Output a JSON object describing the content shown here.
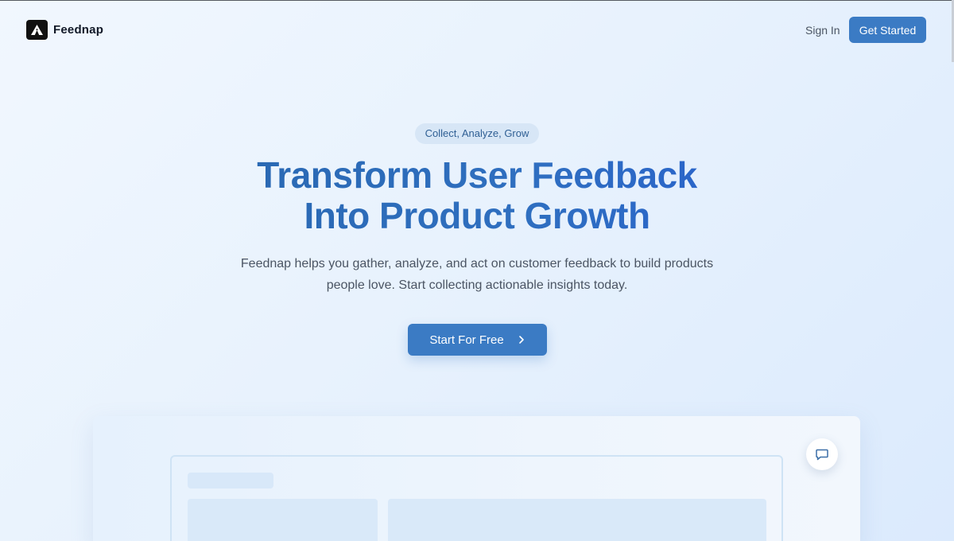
{
  "brand": {
    "name": "Feednap",
    "logo_icon": "triangle-logo-icon"
  },
  "nav": {
    "sign_in": "Sign In",
    "get_started": "Get Started"
  },
  "hero": {
    "tag": "Collect, Analyze, Grow",
    "headline_line1": "Transform User Feedback",
    "headline_line2": "Into Product Growth",
    "subtext_line1": "Feednap helps you gather, analyze, and act on customer feedback to build products",
    "subtext_line2": "people love. Start collecting actionable insights today.",
    "cta_label": "Start For Free"
  },
  "preview": {
    "chat_icon": "message-square-icon"
  },
  "colors": {
    "primary": "#3b7bc4",
    "headline_start": "#2563a8",
    "headline_end": "#2458d6",
    "pill_bg": "#d7e6f6"
  }
}
